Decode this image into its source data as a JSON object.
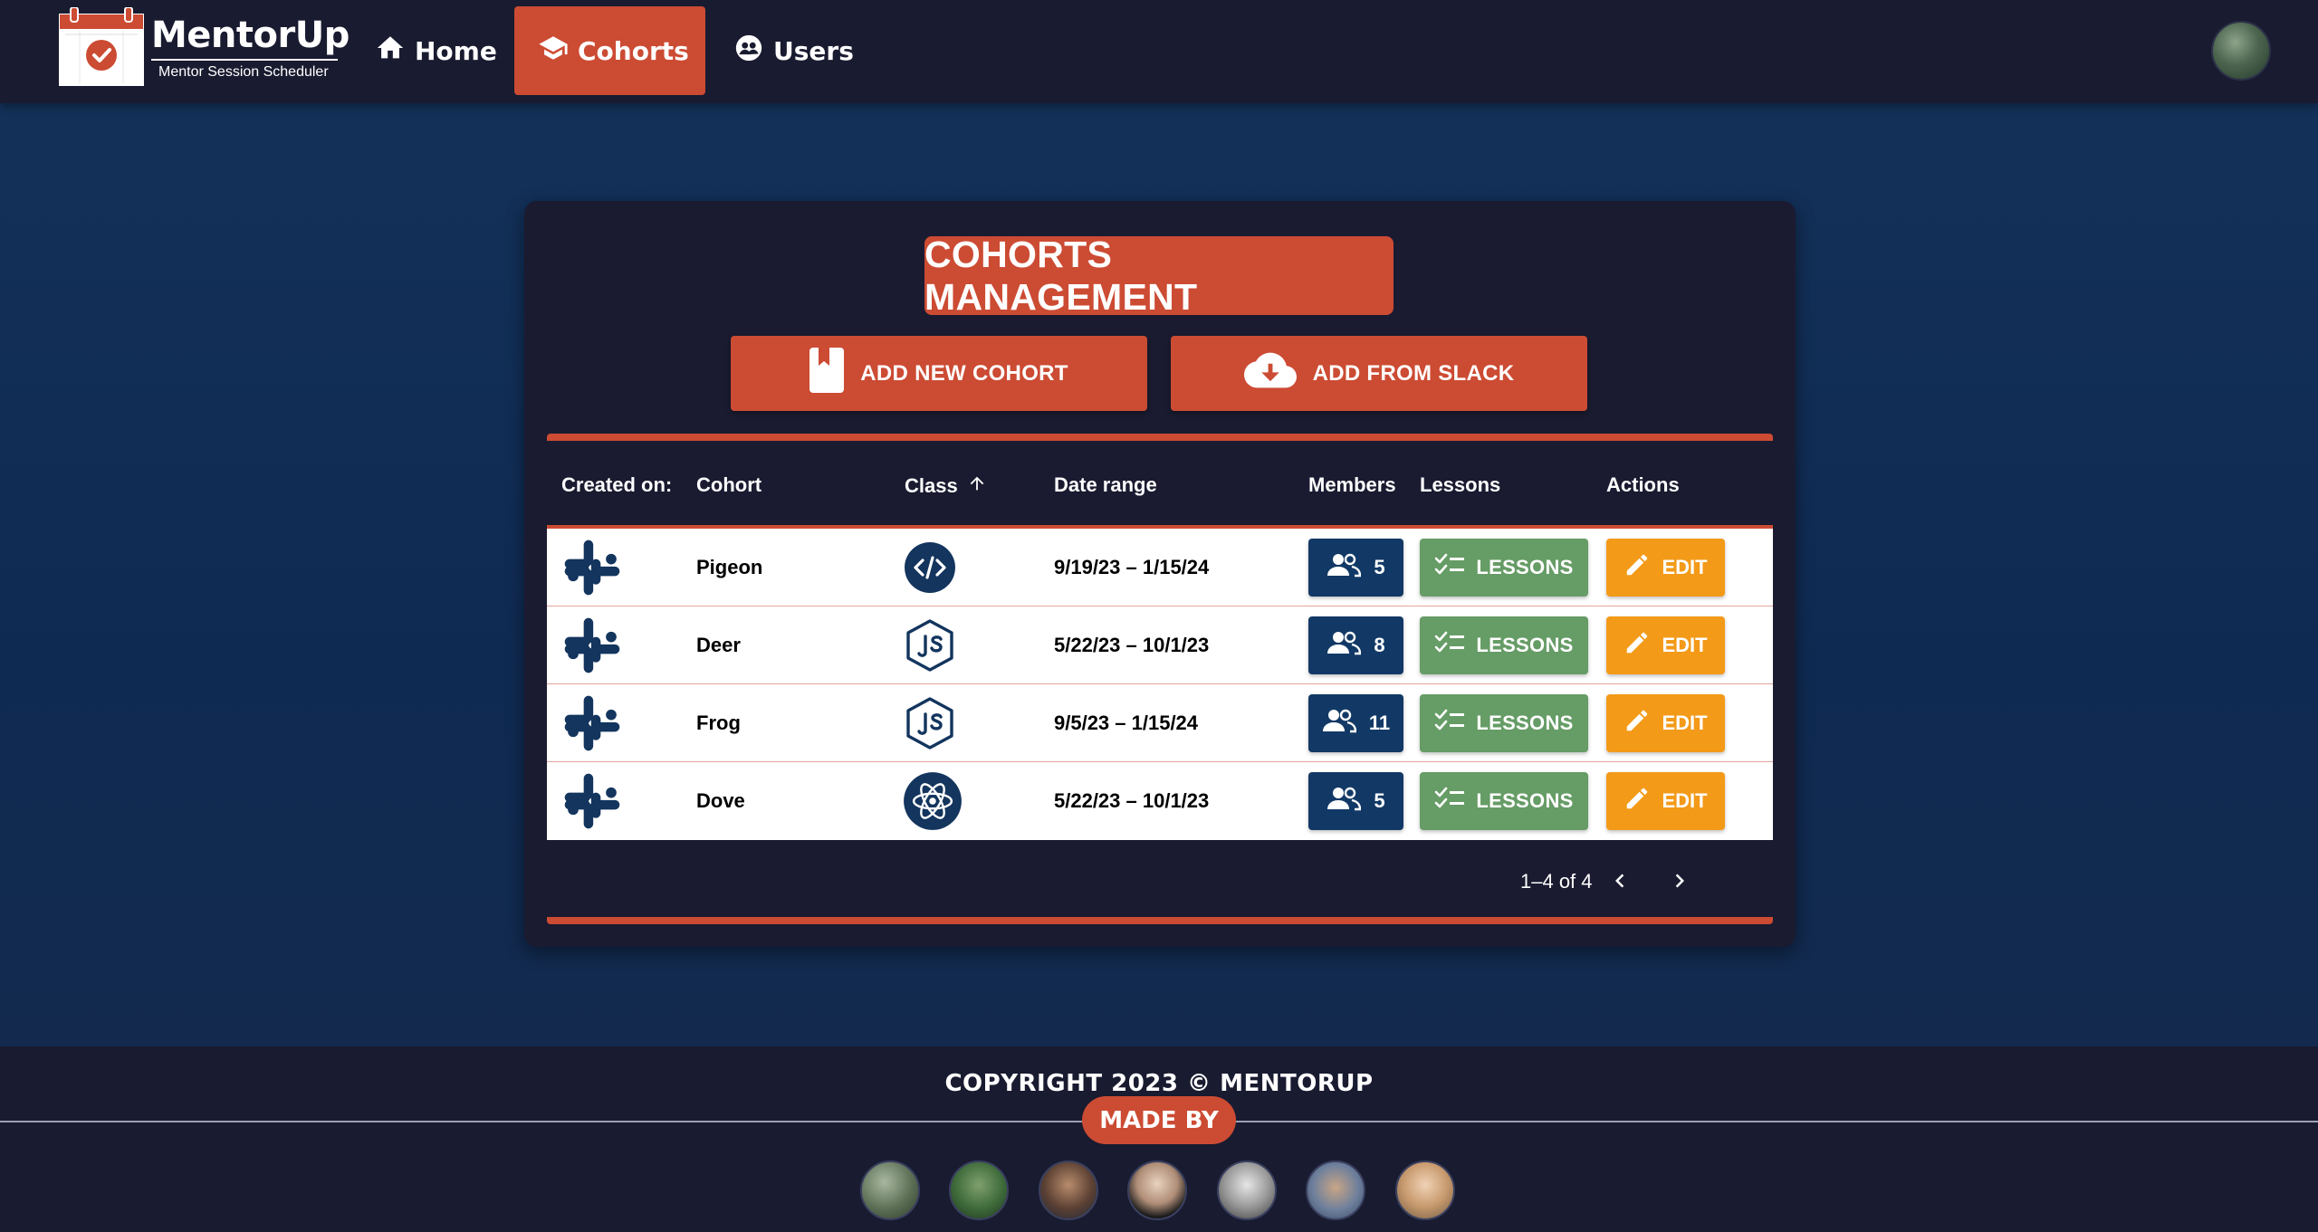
{
  "app": {
    "name": "MentorUp",
    "tagline": "Mentor Session Scheduler"
  },
  "nav": {
    "items": [
      {
        "label": "Home",
        "icon": "home-icon",
        "active": false
      },
      {
        "label": "Cohorts",
        "icon": "graduation-cap-icon",
        "active": true
      },
      {
        "label": "Users",
        "icon": "users-globe-icon",
        "active": false
      }
    ]
  },
  "page": {
    "title": "COHORTS MANAGEMENT",
    "add_cohort_label": "ADD NEW COHORT",
    "add_slack_label": "ADD FROM SLACK"
  },
  "table": {
    "headers": {
      "created_on": "Created on:",
      "cohort": "Cohort",
      "class": "Class",
      "date_range": "Date range",
      "members": "Members",
      "lessons": "Lessons",
      "actions": "Actions"
    },
    "sort": {
      "column": "class",
      "direction": "ascending"
    },
    "rows": [
      {
        "created_on_icon": "slack-icon",
        "cohort": "Pigeon",
        "class_icon": "code-icon",
        "date_range": "9/19/23 – 1/15/24",
        "members": "5",
        "lessons_label": "LESSONS",
        "edit_label": "EDIT"
      },
      {
        "created_on_icon": "slack-icon",
        "cohort": "Deer",
        "class_icon": "nodejs-icon",
        "date_range": "5/22/23 – 10/1/23",
        "members": "8",
        "lessons_label": "LESSONS",
        "edit_label": "EDIT"
      },
      {
        "created_on_icon": "slack-icon",
        "cohort": "Frog",
        "class_icon": "nodejs-icon",
        "date_range": "9/5/23 – 1/15/24",
        "members": "11",
        "lessons_label": "LESSONS",
        "edit_label": "EDIT"
      },
      {
        "created_on_icon": "slack-icon",
        "cohort": "Dove",
        "class_icon": "react-icon",
        "date_range": "5/22/23 – 10/1/23",
        "members": "5",
        "lessons_label": "LESSONS",
        "edit_label": "EDIT"
      }
    ],
    "pagination": "1–4 of 4"
  },
  "footer": {
    "copyright": "COPYRIGHT 2023 © MENTORUP",
    "made_by": "MADE BY",
    "team_count": 7
  },
  "colors": {
    "accent": "#cc4b33",
    "navbar": "#191b30",
    "card": "#1a1b30",
    "members_badge": "#123966",
    "lessons_button": "#669c66",
    "edit_button": "#f39a18"
  }
}
